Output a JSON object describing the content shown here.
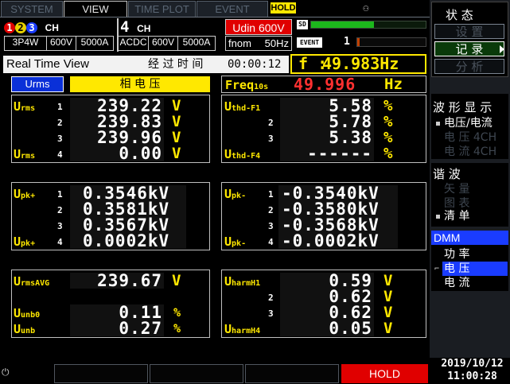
{
  "tabs": [
    "SYSTEM",
    "VIEW",
    "TIME PLOT",
    "EVENT"
  ],
  "hold_badge": "HOLD",
  "channels": {
    "group1_nums": [
      "1",
      "2",
      "3"
    ],
    "group1_suffix": "CH",
    "group1_wiring": "3P4W",
    "group1_range_v": "600V",
    "group1_range_a": "5000A",
    "ch4_num": "4",
    "ch4_suffix": "CH",
    "ch4_coupling": "ACDC",
    "ch4_range_v": "600V",
    "ch4_range_a": "5000A"
  },
  "udin": "Udin 600V",
  "fnom_label": "fnom",
  "fnom_value": "50Hz",
  "sd_label": "SD",
  "sd_fill": 0.55,
  "event_label": "EVENT",
  "event_count": "1",
  "title_bar": {
    "title": "Real Time View",
    "elapsed_label": "经 过 时 间",
    "elapsed_value": "00:00:12",
    "freq_label": "f :",
    "freq_value": "49.983Hz"
  },
  "mode_selector": {
    "button": "Urms",
    "label": "相 电 压"
  },
  "freq10s": {
    "label_main": "Freq",
    "label_sub": "10s",
    "value": "49.996",
    "unit": "Hz"
  },
  "urms": {
    "label": "U",
    "label_sub": "rms",
    "channels": [
      "1",
      "2",
      "3",
      "4"
    ],
    "values": [
      "239.22",
      "239.83",
      "239.96",
      "0.00"
    ],
    "unit": "V"
  },
  "uthd": {
    "label": "U",
    "label_sub_1": "thd-F1",
    "label_sub_4": "thd-F4",
    "channels": [
      "1",
      "2",
      "3",
      "4"
    ],
    "values": [
      "5.58",
      "5.78",
      "5.38",
      "------"
    ],
    "unit": "%"
  },
  "upk_plus": {
    "label": "U",
    "label_sub": "pk+",
    "channels": [
      "1",
      "2",
      "3",
      "4"
    ],
    "values": [
      "0.3546kV",
      "0.3581kV",
      "0.3567kV",
      "0.0002kV"
    ]
  },
  "upk_minus": {
    "label": "U",
    "label_sub": "pk-",
    "channels": [
      "1",
      "2",
      "3",
      "4"
    ],
    "values": [
      "-0.3540kV",
      "-0.3580kV",
      "-0.3568kV",
      "-0.0002kV"
    ]
  },
  "urms_avg": {
    "label": "U",
    "label_sub": "rmsAVG",
    "value": "239.67",
    "unit": "V"
  },
  "unb": {
    "unb0_label": "U",
    "unb0_sub": "unb0",
    "unb0_value": "0.11",
    "unb0_unit": "%",
    "unb_label": "U",
    "unb_sub": "unb",
    "unb_value": "0.27",
    "unb_unit": "%"
  },
  "uharm": {
    "label": "U",
    "label_sub_1": "harmH1",
    "label_sub_4": "harmH4",
    "channels": [
      "1",
      "2",
      "3",
      "4"
    ],
    "values": [
      "0.59",
      "0.62",
      "0.62",
      "0.05"
    ],
    "unit": "V"
  },
  "right_panel": {
    "status_title": "状 态",
    "status_buttons": [
      "设 置",
      "记 录",
      "分 析"
    ],
    "waveform_title": "波 形 显 示",
    "waveform_items": [
      "电压/电流",
      "电 压 4CH",
      "电 流 4CH"
    ],
    "harmonic_title": "谐 波",
    "harmonic_items": [
      "矢 量",
      "图 表",
      "清 单"
    ],
    "dmm_title": "DMM",
    "dmm_items": [
      "功 率",
      "电 压",
      "电 流"
    ]
  },
  "footer": {
    "hold_button": "HOLD",
    "date": "2019/10/12",
    "time": "11:00:28"
  },
  "colors": {
    "accent_yellow": "#ffe800",
    "hold_red": "#e00000",
    "active_blue": "#1a3cff",
    "record_green": "#0a3a0a"
  }
}
